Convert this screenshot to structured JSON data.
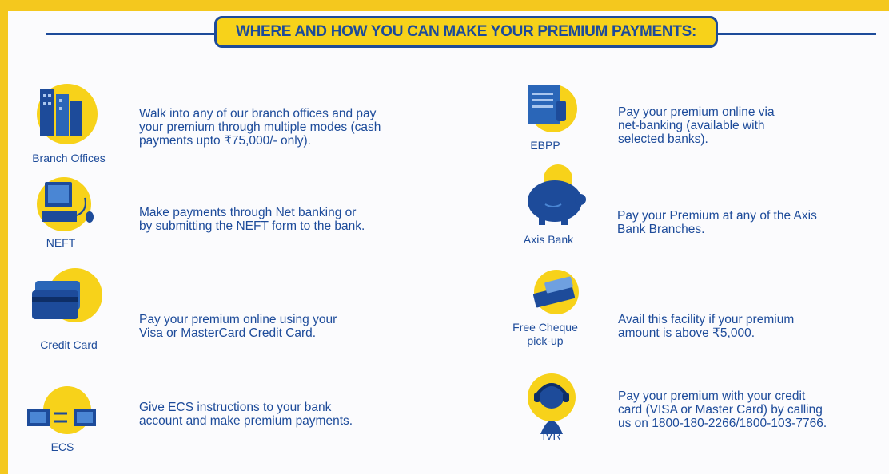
{
  "header": {
    "title": "WHERE AND HOW YOU CAN MAKE YOUR PREMIUM PAYMENTS:"
  },
  "left": [
    {
      "icon": "building-icon",
      "label": "Branch Offices",
      "desc": [
        "Walk into any of our branch offices and pay",
        "your premium through multiple modes (cash",
        "payments upto ₹75,000/- only)."
      ]
    },
    {
      "icon": "computer-icon",
      "label": "NEFT",
      "desc": [
        "Make payments through Net banking or",
        "by submitting the NEFT form to the bank."
      ]
    },
    {
      "icon": "credit-card-icon",
      "label": "Credit Card",
      "desc": [
        "Pay your premium online using your",
        "Visa or MasterCard Credit Card."
      ]
    },
    {
      "icon": "transfer-icon",
      "label": "ECS",
      "desc": [
        "Give ECS instructions to your bank",
        "account and make premium payments."
      ]
    }
  ],
  "right": [
    {
      "icon": "bill-icon",
      "label": "EBPP",
      "desc": [
        "Pay your premium online via",
        "net-banking (available with",
        "selected banks)."
      ]
    },
    {
      "icon": "piggy-bank-icon",
      "label": "Axis Bank",
      "desc": [
        "Pay your Premium at any of the Axis",
        "Bank Branches."
      ]
    },
    {
      "icon": "cheque-icon",
      "label": [
        "Free Cheque",
        "pick-up"
      ],
      "desc": [
        "Avail this facility if your premium",
        "amount is above ₹5,000."
      ]
    },
    {
      "icon": "headset-icon",
      "label": "IVR",
      "desc": [
        "Pay your premium with your credit",
        "card (VISA or Master Card) by calling",
        "us on 1800-180-2266/1800-103-7766."
      ]
    }
  ],
  "colors": {
    "brand_blue": "#1d4b9a",
    "brand_yellow": "#f4c81e"
  }
}
